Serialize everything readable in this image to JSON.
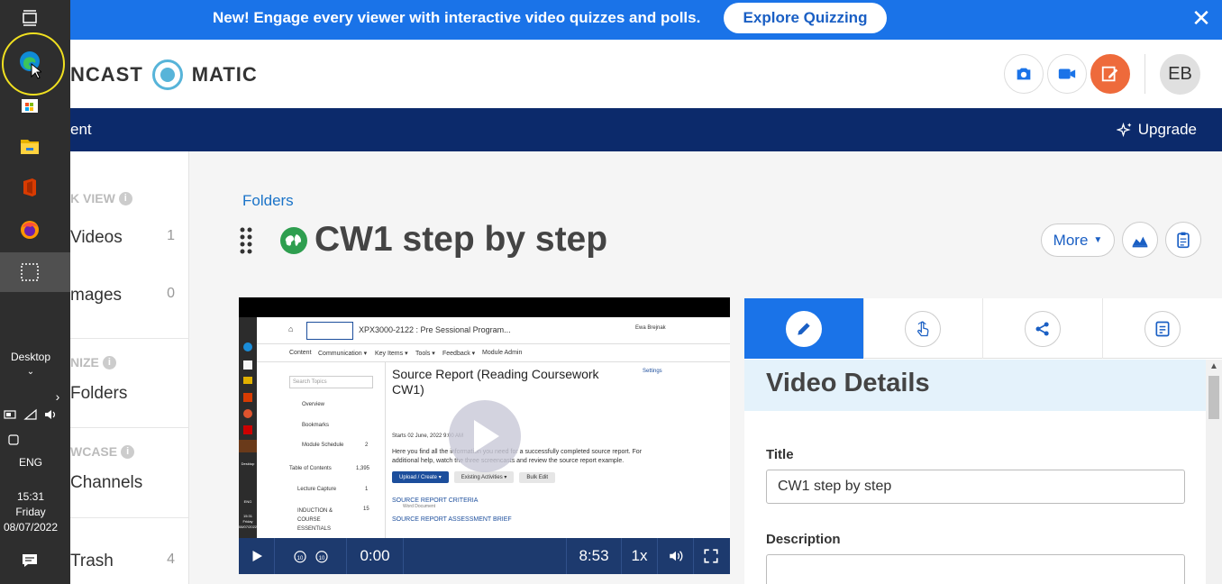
{
  "banner": {
    "text": "New! Engage every viewer with interactive video quizzes and polls.",
    "cta": "Explore Quizzing",
    "close": "✕"
  },
  "header": {
    "logo_left": "NCAST",
    "logo_right": "MATIC",
    "avatar": "EB"
  },
  "navbar": {
    "item": "ent",
    "upgrade": "Upgrade"
  },
  "sidebar": {
    "section1": "K VIEW",
    "items1": [
      {
        "label": "Videos",
        "count": "1"
      },
      {
        "label": "mages",
        "count": "0"
      }
    ],
    "section2": "NIZE",
    "folders": "Folders",
    "section3": "WCASE",
    "channels": "Channels",
    "trash": {
      "label": "Trash",
      "count": "4"
    }
  },
  "main": {
    "breadcrumb": "Folders",
    "title": "CW1 step by step",
    "more": "More"
  },
  "video": {
    "current_time": "0:00",
    "duration": "8:53",
    "speed": "1x",
    "buffered_fraction": 0.06,
    "frame": {
      "course": "XPX3000-2122 : Pre Sessional Program...",
      "user": "Ewa Brejnak",
      "menu": [
        "Content",
        "Communication ▾",
        "Key Items ▾",
        "Tools ▾",
        "Feedback ▾",
        "Module Admin"
      ],
      "search": "Search Topics",
      "left_items": [
        "Overview",
        "Bookmarks",
        "Module Schedule",
        "Table of Contents",
        "Lecture Capture",
        "INDUCTION & COURSE ESSENTIALS"
      ],
      "left_counts": [
        "2",
        "1,395",
        "1",
        "15"
      ],
      "heading": "Source Report (Reading Coursework CW1)",
      "settings": "Settings",
      "starts": "Starts 02 June, 2022 9:00 AM",
      "desc": "Here you find all the information you need for a successfully completed source report. For additional help, watch the three screencasts and review the source report example.",
      "btn_upload": "Upload / Create ▾",
      "btn_existing": "Existing Activities ▾",
      "btn_bulk": "Bulk Edit",
      "items": [
        "SOURCE REPORT CRITERIA",
        "SOURCE REPORT ASSESSMENT BRIEF"
      ],
      "item_sub": "Word Document",
      "taskbar_desktop": "Desktop",
      "taskbar_lang": "ENG",
      "taskbar_time": "15:31",
      "taskbar_day": "Friday",
      "taskbar_date": "08/07/2022"
    }
  },
  "panel": {
    "title": "Video Details",
    "title_label": "Title",
    "title_value": "CW1 step by step",
    "description_label": "Description"
  },
  "taskbar": {
    "desktop": "Desktop",
    "lang": "ENG",
    "time": "15:31",
    "day": "Friday",
    "date": "08/07/2022"
  },
  "colors": {
    "banner": "#1a73e8",
    "navbar": "#0c2a6b",
    "accent_orange": "#ee6a3b",
    "player_bar": "#1d3a6e"
  }
}
